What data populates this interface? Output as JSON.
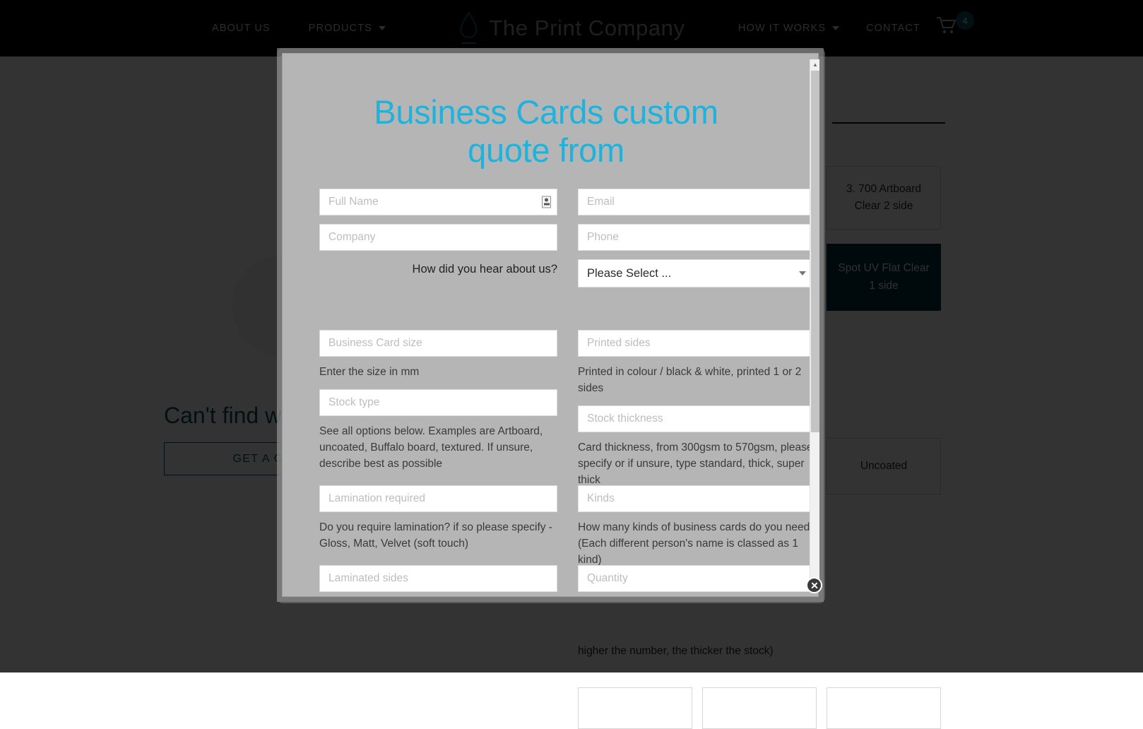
{
  "header": {
    "nav_left": [
      {
        "label": "ABOUT US",
        "has_caret": false,
        "name": "about-us"
      },
      {
        "label": "PRODUCTS",
        "has_caret": true,
        "name": "products"
      }
    ],
    "nav_right": [
      {
        "label": "HOW IT WORKS",
        "has_caret": true,
        "name": "how-it-works"
      },
      {
        "label": "CONTACT",
        "has_caret": false,
        "name": "contact"
      }
    ],
    "brand_name": "The Print Company",
    "brand_icon": "water-droplet-icon",
    "cart_icon": "shopping-cart-icon",
    "cart_count": "4",
    "badge_color": "#0d5360",
    "background": "#000000"
  },
  "page": {
    "cta_heading": "Can't find wha",
    "cta_button": "GET A CUSTOM",
    "accent_color": "#0d5360",
    "cards": [
      {
        "label": "3. 700 Artboard\nClear 2 side",
        "teal": false
      },
      {
        "label": "Spot UV Flat\nClear 1 side",
        "teal": true
      },
      {
        "label": "Uncoated",
        "teal": false
      }
    ],
    "note_text": "higher the number, the thicker the stock)"
  },
  "modal": {
    "title": "Business Cards custom quote from",
    "title_color": "#1db3dd",
    "close_icon": "close-circle-icon",
    "scrollbar": {
      "up_icon": "chevron-up-icon",
      "down_icon": "chevron-down-icon"
    },
    "fields": {
      "full_name": {
        "placeholder": "Full Name",
        "value": "",
        "icon": "contact-card-icon"
      },
      "email": {
        "placeholder": "Email",
        "value": ""
      },
      "company": {
        "placeholder": "Company",
        "value": ""
      },
      "phone": {
        "placeholder": "Phone",
        "value": ""
      },
      "hear_about_label": "How did you hear about us?",
      "hear_about_select": "Please Select ...",
      "card_size": {
        "placeholder": "Business Card size",
        "value": ""
      },
      "card_size_help": "Enter the size in mm",
      "printed_sides": {
        "placeholder": "Printed sides",
        "value": ""
      },
      "printed_sides_help": "Printed in colour / black & white, printed 1 or 2 sides",
      "stock_type": {
        "placeholder": "Stock type",
        "value": ""
      },
      "stock_type_help": "See all options below. Examples are Artboard, uncoated, Buffalo board, textured. If unsure, describe best as possible",
      "stock_thickness": {
        "placeholder": "Stock thickness",
        "value": ""
      },
      "stock_thickness_help": "Card thickness, from 300gsm to 570gsm, please specify or if unsure, type standard, thick, super thick",
      "lamination": {
        "placeholder": "Lamination required",
        "value": ""
      },
      "lamination_help": "Do you require lamination? if so please specify - Gloss, Matt, Velvet (soft touch)",
      "kinds": {
        "placeholder": "Kinds",
        "value": ""
      },
      "kinds_help": "How many kinds of business cards do you need? (Each different person's name is classed as 1 kind)",
      "laminated_sides": {
        "placeholder": "Laminated sides",
        "value": ""
      },
      "quantity": {
        "placeholder": "Quantity",
        "value": ""
      }
    }
  }
}
